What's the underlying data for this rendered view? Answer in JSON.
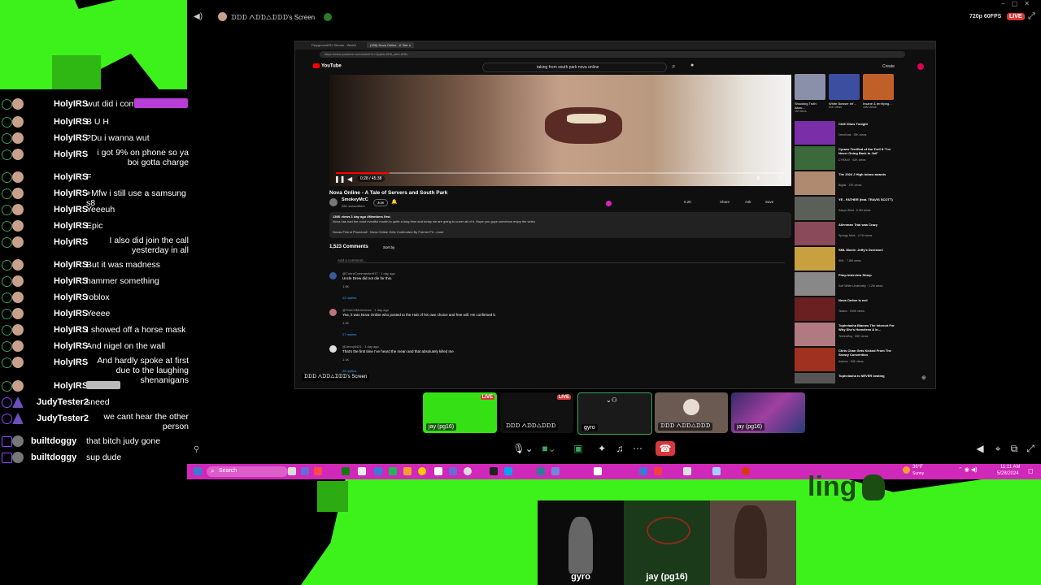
{
  "topbar": {
    "screen_title": "ᗪᗪᗪ ᐱᗪᗪ△ᗪᗪᗪ's Screen",
    "quality": "720p 60FPS",
    "live": "LIVE"
  },
  "chat": [
    {
      "name": "HolyIRS",
      "text": "wut did i come ...",
      "align": "left"
    },
    {
      "name": "HolyIRS",
      "text": "B U H",
      "align": "left"
    },
    {
      "name": "HolyIRS",
      "text": "?Du i wanna wut",
      "align": "left"
    },
    {
      "name": "HolyIRS",
      "text": "i got 9% on phone so ya boi gotta charge",
      "align": "right"
    },
    {
      "name": "HolyIRS",
      "text": "F",
      "align": "left"
    },
    {
      "name": "HolyIRS",
      "text": "+Mfw i still use a samsung s8",
      "align": "left"
    },
    {
      "name": "HolyIRS",
      "text": "Yeeeuh",
      "align": "left"
    },
    {
      "name": "HolyIRS",
      "text": "Epic",
      "align": "left"
    },
    {
      "name": "HolyIRS",
      "text": "I also did join the call yesterday in all",
      "align": "right"
    },
    {
      "name": "HolyIRS",
      "text": "But it was madness",
      "align": "left"
    },
    {
      "name": "HolyIRS",
      "text": "hammer something",
      "align": "left"
    },
    {
      "name": "HolyIRS",
      "text": "roblox",
      "align": "left"
    },
    {
      "name": "HolyIRS",
      "text": "Yeeee",
      "align": "left"
    },
    {
      "name": "HolyIRS",
      "text": "I showed off a horse mask",
      "align": "left"
    },
    {
      "name": "HolyIRS",
      "text": "And nigel on the wall",
      "align": "left"
    },
    {
      "name": "HolyIRS",
      "text": "And hardly spoke at first due to the laughing shenanigans",
      "align": "right"
    },
    {
      "name": "HolyIRS",
      "text": "",
      "align": "left"
    },
    {
      "name": "JudyTester2",
      "text": "sneed",
      "align": "left"
    },
    {
      "name": "JudyTester2",
      "text": "we cant hear the other person",
      "align": "right"
    },
    {
      "name": "builtdoggy",
      "text": "that bitch judy gone",
      "align": "left"
    },
    {
      "name": "builtdoggy",
      "text": "sup dude",
      "align": "left"
    }
  ],
  "browser": {
    "tabs": [
      "Playground/RJ Stream - Watch",
      "(288) Nova Online - A Tale o"
    ],
    "url": "https://www.youtube.com/watch?v=Cjqdm-8H8_sdm-dOfu",
    "search": "taking from south park nova online",
    "create": "Create"
  },
  "video": {
    "time": "0:28 / 45:38",
    "title": "Nova Online - A Tale of Servers and South Park",
    "channel": "SmokeyMcC",
    "subs": "38K subscribers",
    "join": "Join",
    "likes": "6.2K",
    "share": "Share",
    "ask": "Ask",
    "save": "Save",
    "meta": "136K views  1 day ago  #Members first",
    "desc1": "Nova has had the most eventful month in quite a long time and today we are going to cover all of it. Hope you guys somehow enjoy the video",
    "desc2": "Novas Friend Phonecall  ·  Nova Online Gets Confronted By Former Fri...more",
    "comments_count": "1,523 Comments",
    "sort": "Sort by",
    "add_comment": "Add a comment..."
  },
  "comments": [
    {
      "user": "@CobraCommander917 · 1 day ago",
      "text": "Uncle Drew did not die for this.",
      "likes": "1.5K",
      "replies": "22 replies"
    },
    {
      "user": "@TheCHMUniverse · 1 day ago",
      "text": "Yea, it was Nova Online who posted to the Hub of his own choice and free will. He confirmed it.",
      "likes": "1.2K",
      "replies": "27 replies"
    },
    {
      "user": "@Jenny5421 · 1 day ago",
      "text": "That's the first time I've heard the mean and that absolutely killed me",
      "likes": "1.1K",
      "replies": "26 replies"
    }
  ],
  "sidebar_videos": [
    {
      "title": "Chill Vibes Tonight",
      "meta": "DeezNuts · 39K views"
    },
    {
      "title": "Cyraxx Terrified of the Troll It \"I'm Never Going Back to Jail\"",
      "meta": "CYRAXX · 62K views"
    },
    {
      "title": "The 2024 J High tobow awards",
      "meta": "Bigtiki · 37K views"
    },
    {
      "title": "YE - FATHER (feat. TRAVIS SCOTT)",
      "meta": "Kanye West · 8.3M views"
    },
    {
      "title": "Alienman Trial was Crazy",
      "meta": "Spongy Mark · 4.7M views"
    },
    {
      "title": "SML Movie: Jeffy's Decision!",
      "meta": "SML · 7.8M views"
    },
    {
      "title": "Pimp Interview Sharp",
      "meta": "Soft White Underbelly · 1.2M views"
    },
    {
      "title": "Nova Online is evil",
      "meta": "Tactics · 200K views"
    },
    {
      "title": "Topheiasha Blames The Internet For Why She's Homeless & In...",
      "meta": "TechnoBoy · 89K views"
    },
    {
      "title": "Chris Chan Gets Kicked From The Snowy Convention",
      "meta": "Ashens · 54K views"
    },
    {
      "title": "Topheiasha is NEVER beating",
      "meta": "Drama Lab · 33K views"
    }
  ],
  "shorts": [
    {
      "title": "Shocking Truth Abou...",
      "meta": "1M views"
    },
    {
      "title": "White Bowser let'...",
      "meta": "51K views"
    },
    {
      "title": "Insane & terrifying...",
      "meta": "44M views"
    }
  ],
  "tiles": [
    {
      "label": "jay (pg16)",
      "live": true
    },
    {
      "label": "ᗪᗪᗪ ᐱᗪᗪ△ᗪᗪᗪ",
      "live": true
    },
    {
      "label": "gyro",
      "live": false
    },
    {
      "label": "ᗪᗪᗪ ᐱᗪᗪ△ᗪᗪᗪ",
      "live": false
    },
    {
      "label": "jay (pg16)",
      "live": false
    }
  ],
  "taskbar": {
    "search": "Search",
    "weather": "36°F",
    "weather_desc": "Sunny",
    "time": "11:11 AM",
    "date": "5/28/2024"
  },
  "overlay_text": "ling",
  "cams": [
    {
      "label": "gyro"
    },
    {
      "label": "jay (pg16)"
    },
    {
      "label": ""
    }
  ],
  "colors": {
    "green": "#3df21a",
    "yt_red": "#ff0000",
    "taskbar": "#d028b8",
    "discord_red": "#da373c"
  }
}
